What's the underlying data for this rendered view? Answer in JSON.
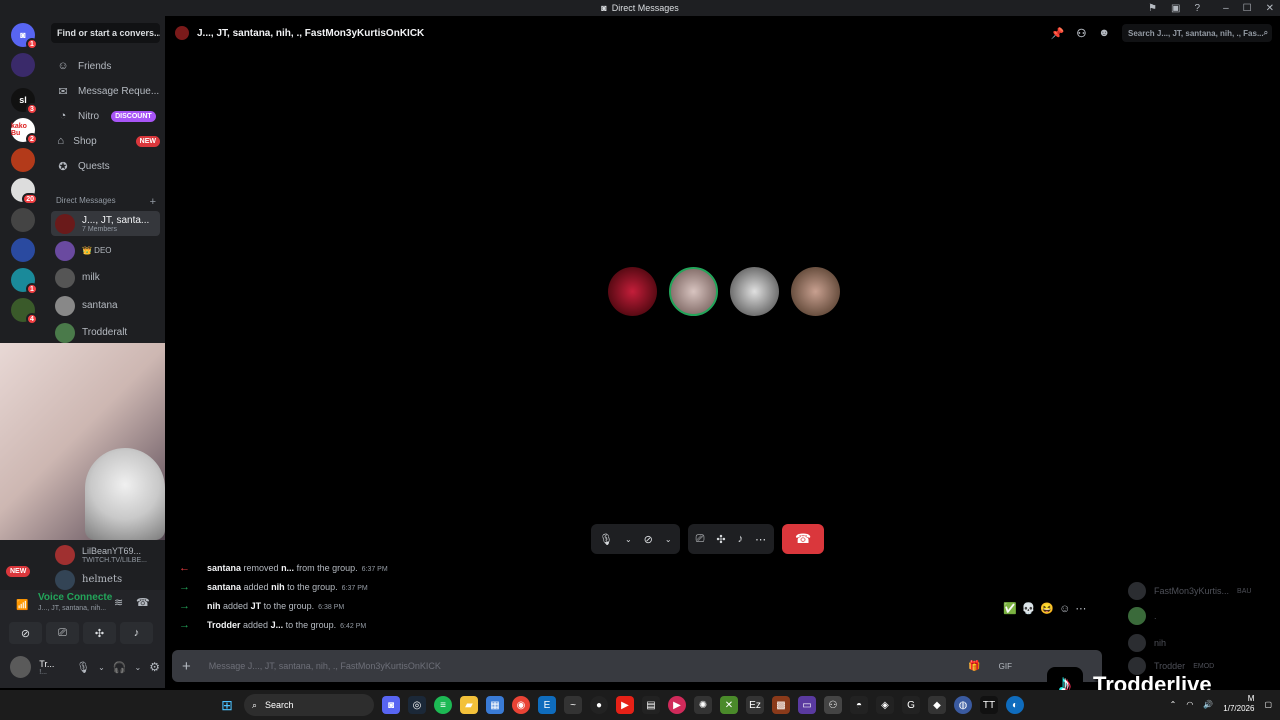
{
  "window": {
    "title": "Direct Messages"
  },
  "sidebar": {
    "search_placeholder": "Find or start a convers...",
    "nav": [
      {
        "label": "Friends",
        "icon": "friends-icon"
      },
      {
        "label": "Message Reque...",
        "icon": "message-requests-icon"
      },
      {
        "label": "Nitro",
        "icon": "nitro-icon",
        "badge": "DISCOUNT"
      },
      {
        "label": "Shop",
        "icon": "shop-icon",
        "badge": "NEW"
      },
      {
        "label": "Quests",
        "icon": "quests-icon"
      }
    ],
    "dm_header": "Direct Messages",
    "dms": [
      {
        "name": "J..., JT, santa...",
        "sub": "7 Members"
      },
      {
        "name": "👑 DEO",
        "sub": ""
      },
      {
        "name": "milk",
        "sub": ""
      },
      {
        "name": "santana",
        "sub": ""
      },
      {
        "name": "Trodderalt",
        "sub": ""
      },
      {
        "name": "LilBeanYT69...",
        "sub": "TWITCH.TV/LILBE..."
      },
      {
        "name": "helmets",
        "sub": ""
      }
    ],
    "new_badge": "NEW"
  },
  "servers": {
    "badges": [
      "1",
      "3",
      "2",
      "20",
      "1",
      "4"
    ],
    "labels": [
      "sl",
      "kako Bu"
    ]
  },
  "channel": {
    "title": "J..., JT, santana, nih, ., FastMon3yKurtisOnKICK",
    "search_placeholder": "Search J..., JT, santana, nih, ., Fas..."
  },
  "messages": [
    {
      "type": "removed",
      "actor": "santana",
      "action": "removed",
      "target": "n...",
      "suffix": "from the group.",
      "time": "6:37 PM",
      "arrow": "←",
      "arrow_color": "#f23f43"
    },
    {
      "type": "added",
      "actor": "santana",
      "action": "added",
      "target": "nih",
      "suffix": "to the group.",
      "time": "6:37 PM",
      "arrow": "→",
      "arrow_color": "#23a55a"
    },
    {
      "type": "added",
      "actor": "nih",
      "action": "added",
      "target": "JT",
      "suffix": "to the group.",
      "time": "6:38 PM",
      "arrow": "→",
      "arrow_color": "#23a55a"
    },
    {
      "type": "added",
      "actor": "Trodder",
      "action": "added",
      "target": "J...",
      "suffix": "to the group.",
      "time": "6:42 PM",
      "arrow": "→",
      "arrow_color": "#23a55a"
    }
  ],
  "composer": {
    "placeholder": "Message J..., JT, santana, nih, ., FastMon3yKurtisOnKICK"
  },
  "members": [
    {
      "name": "FastMon3yKurtis...",
      "tag": "BAU"
    },
    {
      "name": "."
    },
    {
      "name": "nih"
    },
    {
      "name": "Trodder",
      "tag": "EMOD"
    }
  ],
  "voice": {
    "status": "Voice Connecte",
    "sub": "J..., JT, santana, nih..."
  },
  "user": {
    "name": "Tr...",
    "status": "!..."
  },
  "taskbar": {
    "search": "Search",
    "date": "1/7/2026",
    "time": "M"
  },
  "overlay": {
    "tiktok_name": "Trodderlive"
  },
  "colors": {
    "accent": "#5865f2",
    "danger": "#da373c",
    "success": "#23a55a",
    "nitro": "#a855f7"
  }
}
